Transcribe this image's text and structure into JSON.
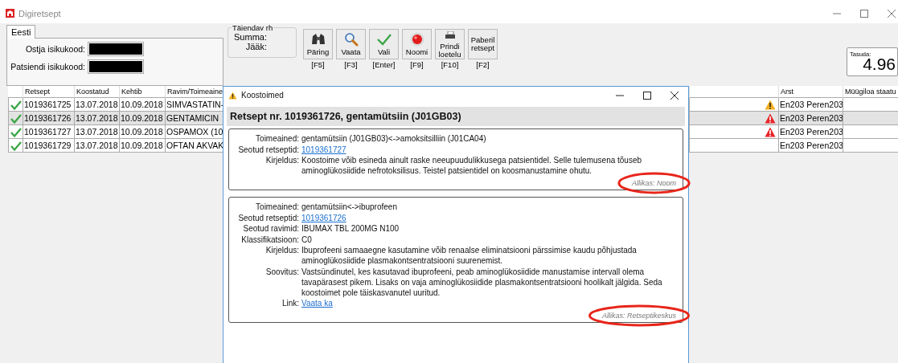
{
  "window": {
    "title": "Digiretsept"
  },
  "tabs": [
    {
      "label": "Eesti",
      "selected": true
    }
  ],
  "id_fields": [
    {
      "label": "Ostja isikukood:",
      "redacted": true
    },
    {
      "label": "Patsiendi isikukood:",
      "redacted": true
    }
  ],
  "supplement_group": {
    "title": "Täiendav rh",
    "labels": [
      "Summa:",
      "Jääk:"
    ]
  },
  "toolbar": [
    {
      "label": "Päring",
      "shortcut": "[F5]",
      "kind": "binoculars"
    },
    {
      "label": "Vaata",
      "shortcut": "[F3]",
      "kind": "search"
    },
    {
      "label": "Vali",
      "shortcut": "[Enter]",
      "kind": "check"
    },
    {
      "label": "Noomi",
      "shortcut": "[F9]",
      "kind": "record"
    },
    {
      "label": "Prindi loetelu",
      "shortcut": "[F10]",
      "kind": "printer"
    },
    {
      "label": "Paberil retsept",
      "shortcut": "[F2]",
      "kind": "text"
    }
  ],
  "total": {
    "label": "Tasuda:",
    "value": "4.96"
  },
  "table": {
    "columns": [
      "Retsept",
      "Koostatud",
      "Kehtib",
      "Ravim/Toimeaine",
      "Arst",
      "Müügiloa staatu"
    ],
    "rows": [
      {
        "valid": true,
        "retsept": "1019361725",
        "koostatud": "13.07.2018",
        "kehtib": "10.09.2018",
        "ravim": "SIMVASTATIN-",
        "warning": true,
        "color": "#f2b01e",
        "arst": "En203 Peren203",
        "selected": false
      },
      {
        "valid": true,
        "retsept": "1019361726",
        "koostatud": "13.07.2018",
        "kehtib": "10.09.2018",
        "ravim": "GENTAMICIN",
        "warning": true,
        "color": "#e8252a",
        "arst": "En203 Peren203",
        "selected": true
      },
      {
        "valid": true,
        "retsept": "1019361727",
        "koostatud": "13.07.2018",
        "kehtib": "10.09.2018",
        "ravim": "OSPAMOX (10",
        "warning": true,
        "color": "#e8252a",
        "arst": "En203 Peren203",
        "selected": false
      },
      {
        "valid": true,
        "retsept": "1019361729",
        "koostatud": "13.07.2018",
        "kehtib": "10.09.2018",
        "ravim": "OFTAN AKVAK",
        "warning": false,
        "arst": "En203 Peren203",
        "selected": false
      }
    ]
  },
  "dialog": {
    "title": "Koostoimed",
    "heading": "Retsept nr. 1019361726, gentamütsiin (J01GB03)",
    "interactions": [
      {
        "fields": [
          {
            "label": "Toimeained:",
            "value": "gentamütsiin (J01GB03)<->amoksitsilliin (J01CA04)",
            "kind": "text"
          },
          {
            "label": "Seotud retseptid:",
            "value": "1019361727",
            "kind": "link"
          },
          {
            "label": "Kirjeldus:",
            "value": "Koostoime võib esineda ainult raske neeupuudulikkusega patsientidel. Selle tulemusena tõuseb aminoglükosiidide nefrotoksilisus. Teistel patsientidel on koosmanustamine ohutu.",
            "kind": "text"
          }
        ],
        "source": "Allikas: Noom",
        "highlighted": true
      },
      {
        "fields": [
          {
            "label": "Toimeained:",
            "value": "gentamütsiin<->ibuprofeen",
            "kind": "text"
          },
          {
            "label": "Seotud retseptid:",
            "value": "1019361726",
            "kind": "link"
          },
          {
            "label": "Seotud ravimid:",
            "value": "IBUMAX TBL 200MG N100",
            "kind": "text"
          },
          {
            "label": "Klassifikatsioon:",
            "value": "C0",
            "kind": "text"
          },
          {
            "label": "Kirjeldus:",
            "value": "Ibuprofeeni samaaegne kasutamine võib renaalse eliminatsiooni pärssimise kaudu põhjustada aminoglükosiidide plasmakontsentratsiooni suurenemist.",
            "kind": "text"
          },
          {
            "label": "Soovitus:",
            "value": "Vastsündinutel, kes kasutavad ibuprofeeni, peab aminoglükosiidide manustamise intervall olema tavapärasest pikem.  Lisaks on vaja aminoglükosiidide plasmakontsentratsiooni hoolikalt jälgida. Seda koostoimet pole täiskasvanutel uuritud.",
            "kind": "text"
          },
          {
            "label": "Link:",
            "value": "Vaata ka",
            "kind": "link"
          }
        ],
        "source": "Allikas: Retseptikeskus",
        "highlighted": true
      }
    ]
  }
}
